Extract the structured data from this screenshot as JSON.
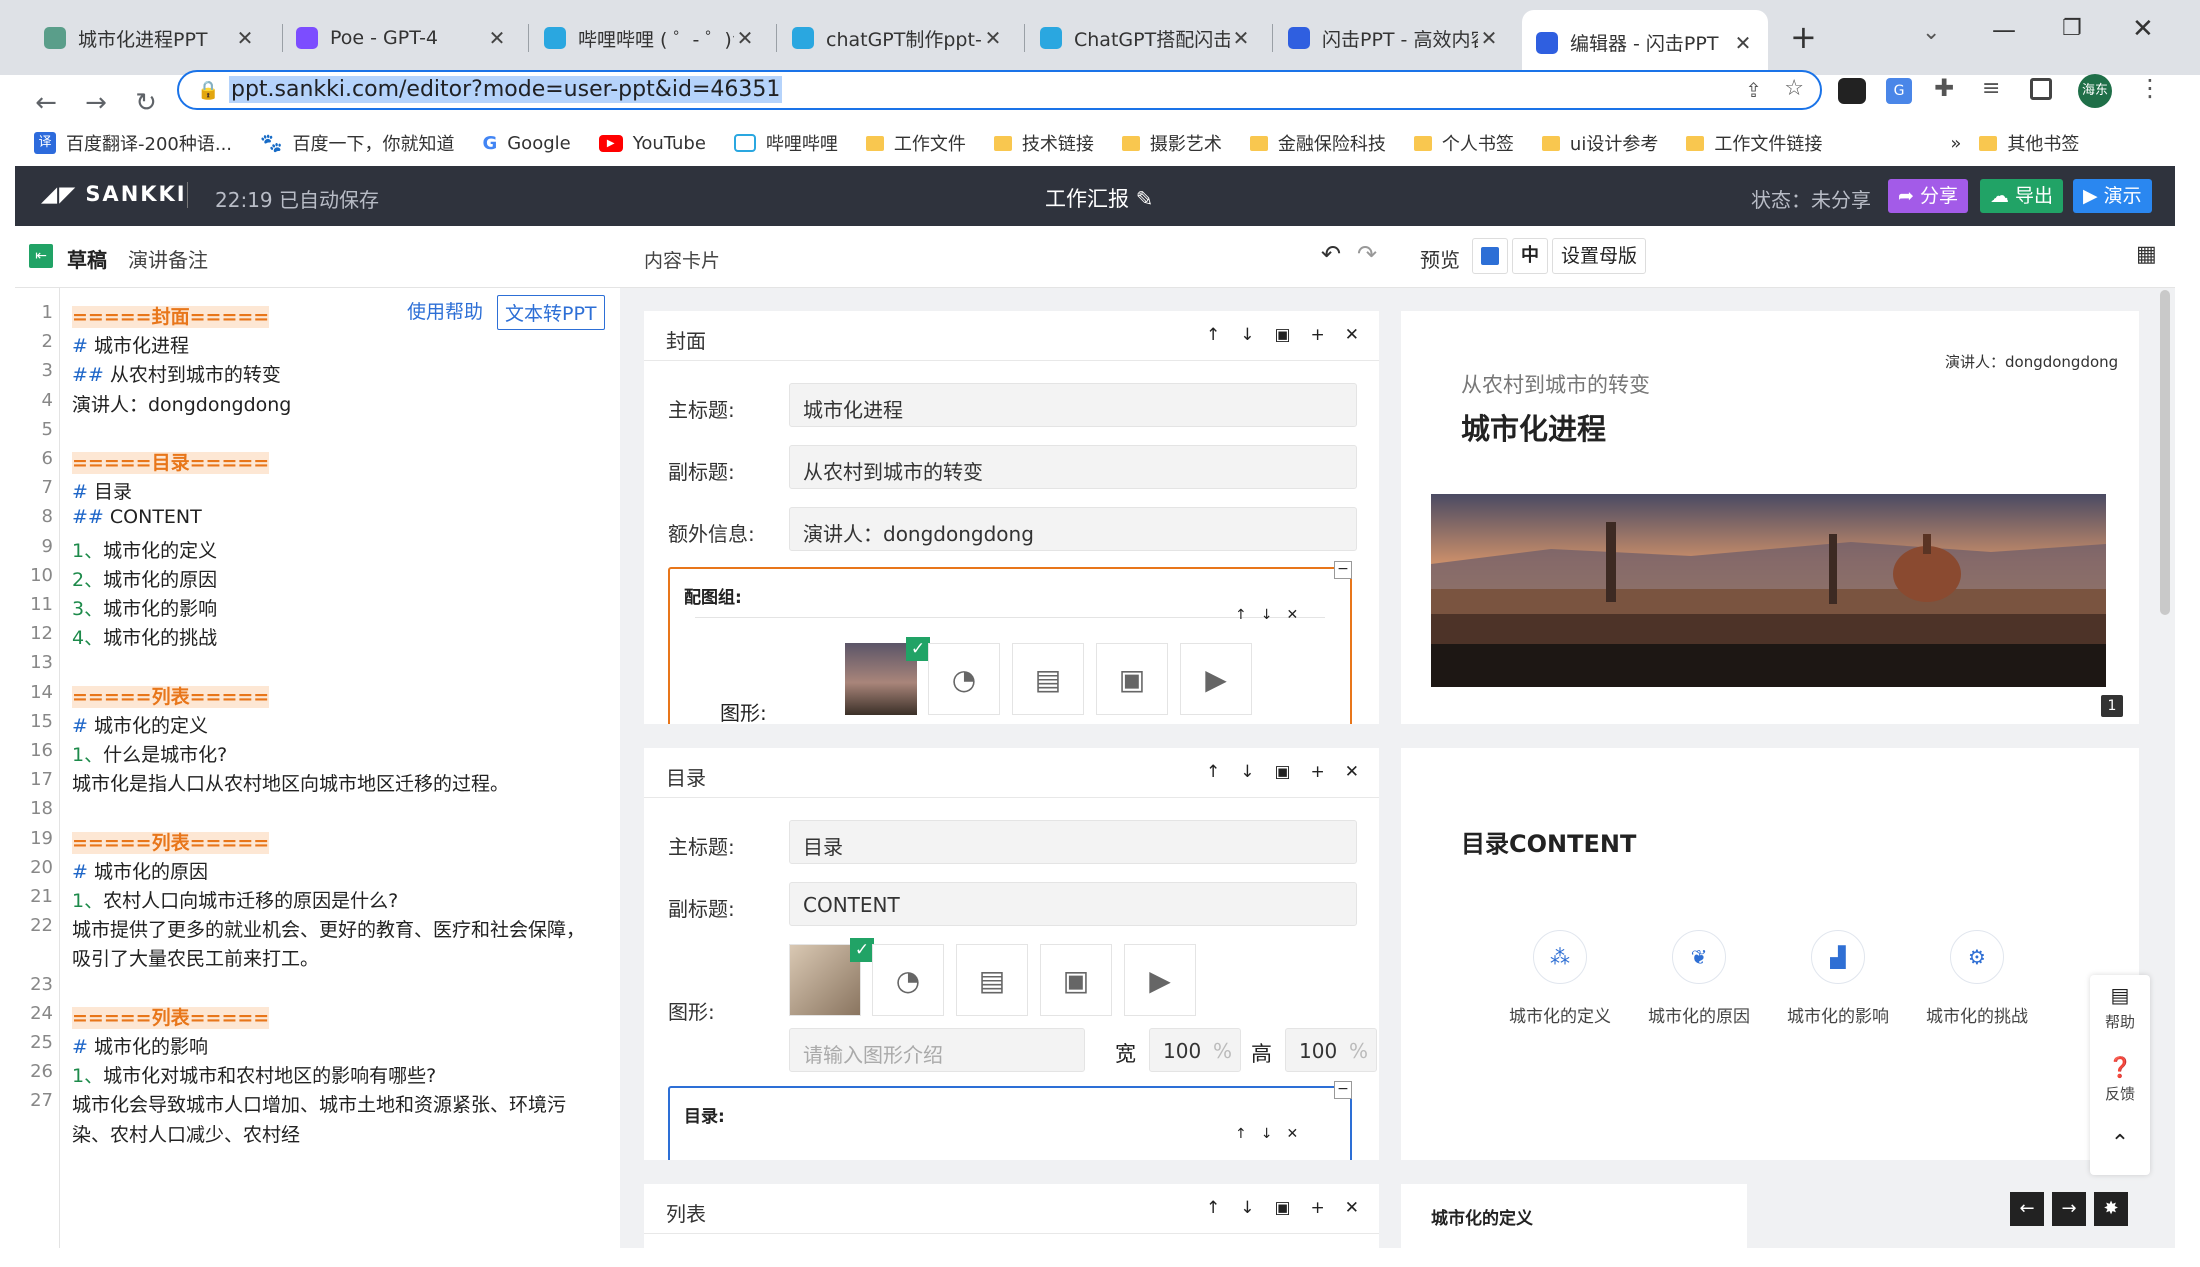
{
  "browser": {
    "tabs": [
      {
        "title": "城市化进程PPT",
        "color": "#5a9e8a"
      },
      {
        "title": "Poe - GPT-4",
        "color": "#7c4dff"
      },
      {
        "title": "哔哩哔哩 ( ゜- ゜)つ",
        "color": "#2aa7e0"
      },
      {
        "title": "chatGPT制作ppt-哔",
        "color": "#2aa7e0"
      },
      {
        "title": "ChatGPT搭配闪击P",
        "color": "#2aa7e0"
      },
      {
        "title": "闪击PPT - 高效内容",
        "color": "#2f5fe0"
      },
      {
        "title": "编辑器 - 闪击PPT",
        "color": "#2f5fe0"
      }
    ],
    "url": "ppt.sankki.com/editor?mode=user-ppt&id=46351",
    "profile": "海东",
    "bookmarks": [
      "百度翻译-200种语...",
      "百度一下，你就知道",
      "Google",
      "YouTube",
      "哔哩哔哩",
      "工作文件",
      "技术链接",
      "摄影艺术",
      "金融保险科技",
      "个人书签",
      "ui设计参考",
      "工作文件链接",
      "其他书签"
    ]
  },
  "app": {
    "logo": "SANKKI",
    "save_status": "22:19 已自动保存",
    "doc_title": "工作汇报",
    "status": "状态：未分享",
    "buttons": {
      "share": "分享",
      "export": "导出",
      "present": "演示"
    }
  },
  "toolbar": {
    "tab_draft": "草稿",
    "tab_notes": "演讲备注",
    "content_cards": "内容卡片",
    "preview": "预览",
    "lang": "中",
    "master": "设置母版"
  },
  "editor": {
    "help": "使用帮助",
    "convert": "文本转PPT",
    "lines": [
      {
        "n": "1",
        "segs": [
          {
            "t": "=====封面=====",
            "c": "sec"
          }
        ]
      },
      {
        "n": "2",
        "segs": [
          {
            "t": "# ",
            "c": "hm"
          },
          {
            "t": "城市化进程",
            "c": ""
          }
        ]
      },
      {
        "n": "3",
        "segs": [
          {
            "t": "## ",
            "c": "hm"
          },
          {
            "t": "从农村到城市的转变",
            "c": ""
          }
        ]
      },
      {
        "n": "4",
        "segs": [
          {
            "t": "演讲人：dongdongdong",
            "c": ""
          }
        ]
      },
      {
        "n": "5",
        "segs": []
      },
      {
        "n": "6",
        "segs": [
          {
            "t": "=====目录=====",
            "c": "sec"
          }
        ]
      },
      {
        "n": "7",
        "segs": [
          {
            "t": "# ",
            "c": "hm"
          },
          {
            "t": "目录",
            "c": ""
          }
        ]
      },
      {
        "n": "8",
        "segs": [
          {
            "t": "## ",
            "c": "hm"
          },
          {
            "t": "CONTENT",
            "c": ""
          }
        ]
      },
      {
        "n": "9",
        "segs": [
          {
            "t": "1、",
            "c": "num"
          },
          {
            "t": "城市化的定义",
            "c": ""
          }
        ]
      },
      {
        "n": "10",
        "segs": [
          {
            "t": "2、",
            "c": "num"
          },
          {
            "t": "城市化的原因",
            "c": ""
          }
        ]
      },
      {
        "n": "11",
        "segs": [
          {
            "t": "3、",
            "c": "num"
          },
          {
            "t": "城市化的影响",
            "c": ""
          }
        ]
      },
      {
        "n": "12",
        "segs": [
          {
            "t": "4、",
            "c": "num"
          },
          {
            "t": "城市化的挑战",
            "c": ""
          }
        ]
      },
      {
        "n": "13",
        "segs": []
      },
      {
        "n": "14",
        "segs": [
          {
            "t": "=====列表=====",
            "c": "sec"
          }
        ]
      },
      {
        "n": "15",
        "segs": [
          {
            "t": "# ",
            "c": "hm"
          },
          {
            "t": "城市化的定义",
            "c": ""
          }
        ]
      },
      {
        "n": "16",
        "segs": [
          {
            "t": "1、",
            "c": "num"
          },
          {
            "t": "什么是城市化?",
            "c": ""
          }
        ]
      },
      {
        "n": "17",
        "segs": [
          {
            "t": "城市化是指人口从农村地区向城市地区迁移的过程。",
            "c": ""
          }
        ]
      },
      {
        "n": "18",
        "segs": []
      },
      {
        "n": "19",
        "segs": [
          {
            "t": "=====列表=====",
            "c": "sec"
          }
        ]
      },
      {
        "n": "20",
        "segs": [
          {
            "t": "# ",
            "c": "hm"
          },
          {
            "t": "城市化的原因",
            "c": ""
          }
        ]
      },
      {
        "n": "21",
        "segs": [
          {
            "t": "1、",
            "c": "num"
          },
          {
            "t": "农村人口向城市迁移的原因是什么?",
            "c": ""
          }
        ]
      },
      {
        "n": "22",
        "segs": [
          {
            "t": "城市提供了更多的就业机会、更好的教育、医疗和社会保障，",
            "c": ""
          }
        ]
      },
      {
        "n": "",
        "segs": [
          {
            "t": "吸引了大量农民工前来打工。",
            "c": ""
          }
        ]
      },
      {
        "n": "23",
        "segs": []
      },
      {
        "n": "24",
        "segs": [
          {
            "t": "=====列表=====",
            "c": "sec"
          }
        ]
      },
      {
        "n": "25",
        "segs": [
          {
            "t": "# ",
            "c": "hm"
          },
          {
            "t": "城市化的影响",
            "c": ""
          }
        ]
      },
      {
        "n": "26",
        "segs": [
          {
            "t": "1、",
            "c": "num"
          },
          {
            "t": "城市化对城市和农村地区的影响有哪些?",
            "c": ""
          }
        ]
      },
      {
        "n": "27",
        "segs": [
          {
            "t": "城市化会导致城市人口增加、城市土地和资源紧张、环境污",
            "c": ""
          }
        ]
      },
      {
        "n": "",
        "segs": [
          {
            "t": "染、农村人口减少、农村经",
            "c": ""
          }
        ]
      }
    ]
  },
  "cards": {
    "cover": {
      "header": "封面",
      "title_label": "主标题:",
      "title_value": "城市化进程",
      "subtitle_label": "副标题:",
      "subtitle_value": "从农村到城市的转变",
      "extra_label": "额外信息:",
      "extra_value": "演讲人：dongdongdong",
      "group_label": "配图组:",
      "shape_label": "图形:"
    },
    "toc": {
      "header": "目录",
      "title_label": "主标题:",
      "title_value": "目录",
      "subtitle_label": "副标题:",
      "subtitle_value": "CONTENT",
      "shape_label": "图形:",
      "shape_placeholder": "请输入图形介绍",
      "width_label": "宽",
      "width_value": "100",
      "height_label": "高",
      "height_value": "100",
      "unit": "%",
      "toc_label": "目录:"
    },
    "list": {
      "header": "列表"
    }
  },
  "preview": {
    "cover": {
      "subtitle": "从农村到城市的转变",
      "title": "城市化进程",
      "speaker": "演讲人：dongdongdong",
      "page": "1"
    },
    "toc": {
      "title": "目录CONTENT",
      "items": [
        "城市化的定义",
        "城市化的原因",
        "城市化的影响",
        "城市化的挑战"
      ]
    },
    "list": {
      "title": "城市化的定义"
    }
  },
  "side_tools": {
    "help": "帮助",
    "feedback": "反馈"
  }
}
